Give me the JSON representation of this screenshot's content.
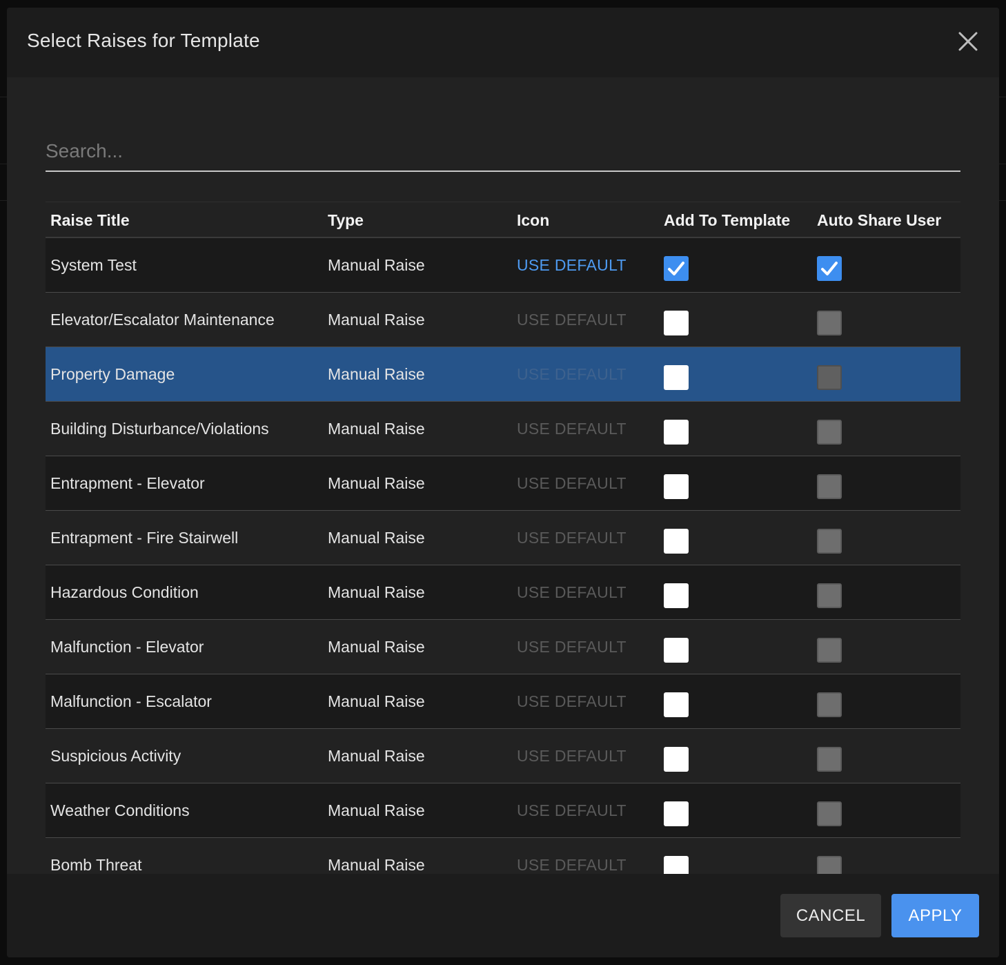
{
  "dialog": {
    "title": "Select Raises for Template",
    "close_icon": "close-icon"
  },
  "search": {
    "placeholder": "Search...",
    "value": ""
  },
  "table": {
    "headers": {
      "title": "Raise Title",
      "type": "Type",
      "icon": "Icon",
      "add": "Add To Template",
      "share": "Auto Share User"
    },
    "rows": [
      {
        "title": "System Test",
        "type": "Manual Raise",
        "icon": "USE DEFAULT",
        "add_checked": true,
        "share_checked": true
      },
      {
        "title": "Elevator/Escalator Maintenance",
        "type": "Manual Raise",
        "icon": "USE DEFAULT",
        "add_checked": false,
        "share_checked": false
      },
      {
        "title": "Property Damage",
        "type": "Manual Raise",
        "icon": "USE DEFAULT",
        "add_checked": false,
        "share_checked": false,
        "selected": true
      },
      {
        "title": "Building Disturbance/Violations",
        "type": "Manual Raise",
        "icon": "USE DEFAULT",
        "add_checked": false,
        "share_checked": false
      },
      {
        "title": "Entrapment - Elevator",
        "type": "Manual Raise",
        "icon": "USE DEFAULT",
        "add_checked": false,
        "share_checked": false
      },
      {
        "title": "Entrapment - Fire Stairwell",
        "type": "Manual Raise",
        "icon": "USE DEFAULT",
        "add_checked": false,
        "share_checked": false
      },
      {
        "title": "Hazardous Condition",
        "type": "Manual Raise",
        "icon": "USE DEFAULT",
        "add_checked": false,
        "share_checked": false
      },
      {
        "title": "Malfunction - Elevator",
        "type": "Manual Raise",
        "icon": "USE DEFAULT",
        "add_checked": false,
        "share_checked": false
      },
      {
        "title": "Malfunction - Escalator",
        "type": "Manual Raise",
        "icon": "USE DEFAULT",
        "add_checked": false,
        "share_checked": false
      },
      {
        "title": "Suspicious Activity",
        "type": "Manual Raise",
        "icon": "USE DEFAULT",
        "add_checked": false,
        "share_checked": false
      },
      {
        "title": "Weather Conditions",
        "type": "Manual Raise",
        "icon": "USE DEFAULT",
        "add_checked": false,
        "share_checked": false
      },
      {
        "title": "Bomb Threat",
        "type": "Manual Raise",
        "icon": "USE DEFAULT",
        "add_checked": false,
        "share_checked": false
      }
    ]
  },
  "footer": {
    "cancel_label": "CANCEL",
    "apply_label": "APPLY"
  },
  "colors": {
    "accent": "#4a92ee",
    "selected_row": "#26548a",
    "link_active": "#4e9af0"
  }
}
